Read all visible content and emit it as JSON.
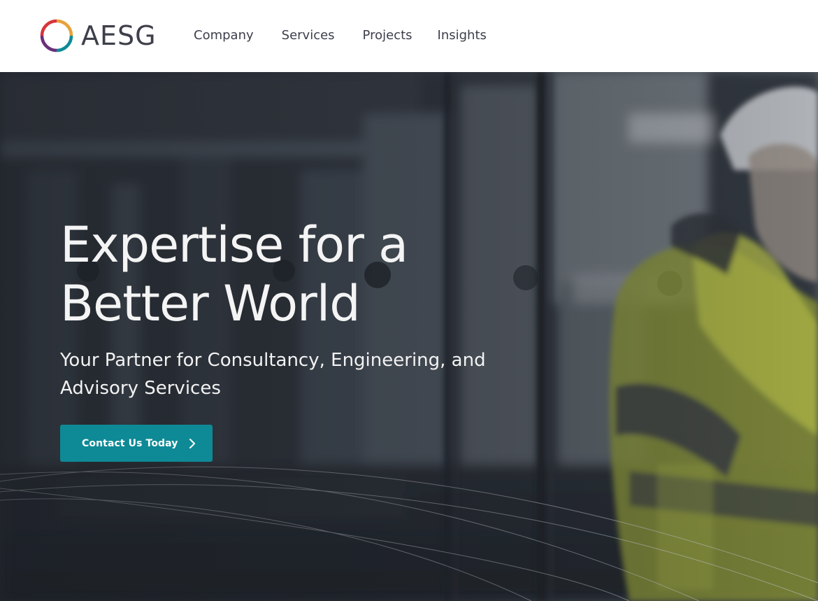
{
  "brand": {
    "name": "AESG",
    "logo_colors": [
      "#e8a23a",
      "#0e8a96",
      "#6a2f7a",
      "#d8343c"
    ]
  },
  "nav": {
    "items": [
      {
        "label": "Company"
      },
      {
        "label": "Services"
      },
      {
        "label": "Projects"
      },
      {
        "label": "Insights"
      }
    ]
  },
  "hero": {
    "title_lines": [
      "Expertise for a",
      "Better World"
    ],
    "subtitle_lines": [
      "Your Partner for Consultancy, Engineering, and",
      "Advisory Services"
    ],
    "cta": {
      "label": "Contact Us Today",
      "icon": "chevron-right-icon"
    },
    "background": "blurred industrial facility interior with engineer in hi-vis jacket and hard hat"
  },
  "colors": {
    "accent": "#0e8a96",
    "nav_text": "#3c3f4b",
    "hero_text": "#f4f4f4"
  }
}
